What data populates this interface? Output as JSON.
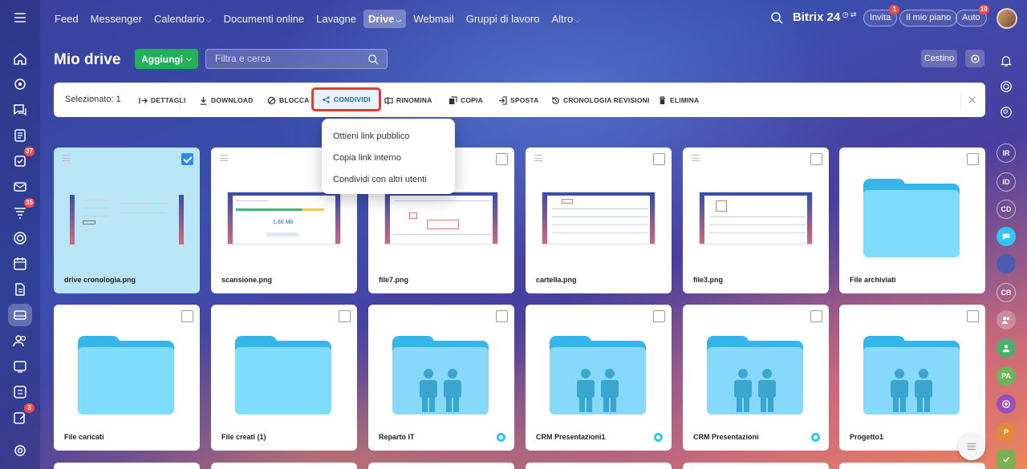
{
  "nav": {
    "items": [
      {
        "label": "Feed",
        "dropdown": false
      },
      {
        "label": "Messenger",
        "dropdown": false
      },
      {
        "label": "Calendario",
        "dropdown": true
      },
      {
        "label": "Documenti online",
        "dropdown": false
      },
      {
        "label": "Lavagne",
        "dropdown": false
      },
      {
        "label": "Drive",
        "dropdown": true,
        "active": true
      },
      {
        "label": "Webmail",
        "dropdown": false
      },
      {
        "label": "Gruppi di lavoro",
        "dropdown": false
      },
      {
        "label": "Altro",
        "dropdown": true
      }
    ]
  },
  "header": {
    "brand": "Bitrix 24",
    "invite_label": "Invita",
    "invite_badge": "1",
    "plan_label": "Il mio piano",
    "auto_label": "Auto",
    "auto_badge": "19"
  },
  "sidebar_badges": {
    "tasks": "37",
    "feed": "35",
    "docs": "3"
  },
  "right_bar": {
    "initials": [
      "IR",
      "ID",
      "CD",
      "CB",
      "PA",
      "P"
    ]
  },
  "page": {
    "title": "Mio drive",
    "add_label": "Aggiungi",
    "filter_placeholder": "Filtra e cerca",
    "trash_label": "Cestino"
  },
  "toolbar": {
    "selected": "Selezionato: 1",
    "buttons": {
      "details": "DETTAGLI",
      "download": "DOWNLOAD",
      "lock": "BLOCCA",
      "share": "CONDIVIDI",
      "rename": "RINOMINA",
      "copy": "COPIA",
      "move": "SPOSTA",
      "history": "CRONOLOGIA REVISIONI",
      "delete": "ELIMINA"
    }
  },
  "share_menu": {
    "items": [
      "Ottieni link pubblico",
      "Copia link interno",
      "Condividi con altri utenti"
    ]
  },
  "tiles": [
    {
      "name": "drive cronologia.png",
      "kind": "image",
      "selected": true
    },
    {
      "name": "scansione.png",
      "kind": "image",
      "thumb_text": "1,68 Mb"
    },
    {
      "name": "file7.png",
      "kind": "image"
    },
    {
      "name": "cartella.png",
      "kind": "image"
    },
    {
      "name": "file3.png",
      "kind": "image"
    },
    {
      "name": "File archiviati",
      "kind": "folder"
    },
    {
      "name": "File caricati",
      "kind": "folder"
    },
    {
      "name": "File creati (1)",
      "kind": "folder"
    },
    {
      "name": "Reparto IT",
      "kind": "shared-folder",
      "shared": true
    },
    {
      "name": "CRM Presentazioni1",
      "kind": "shared-folder",
      "shared": true
    },
    {
      "name": "CRM Presentazioni",
      "kind": "shared-folder",
      "shared": true
    },
    {
      "name": "Progetto1",
      "kind": "shared-folder"
    }
  ],
  "colors": {
    "accent_green": "#23b05b",
    "highlight_red": "#e53935",
    "folder_blue": "#36b5ea",
    "selected_tile": "#b9e6f7"
  }
}
